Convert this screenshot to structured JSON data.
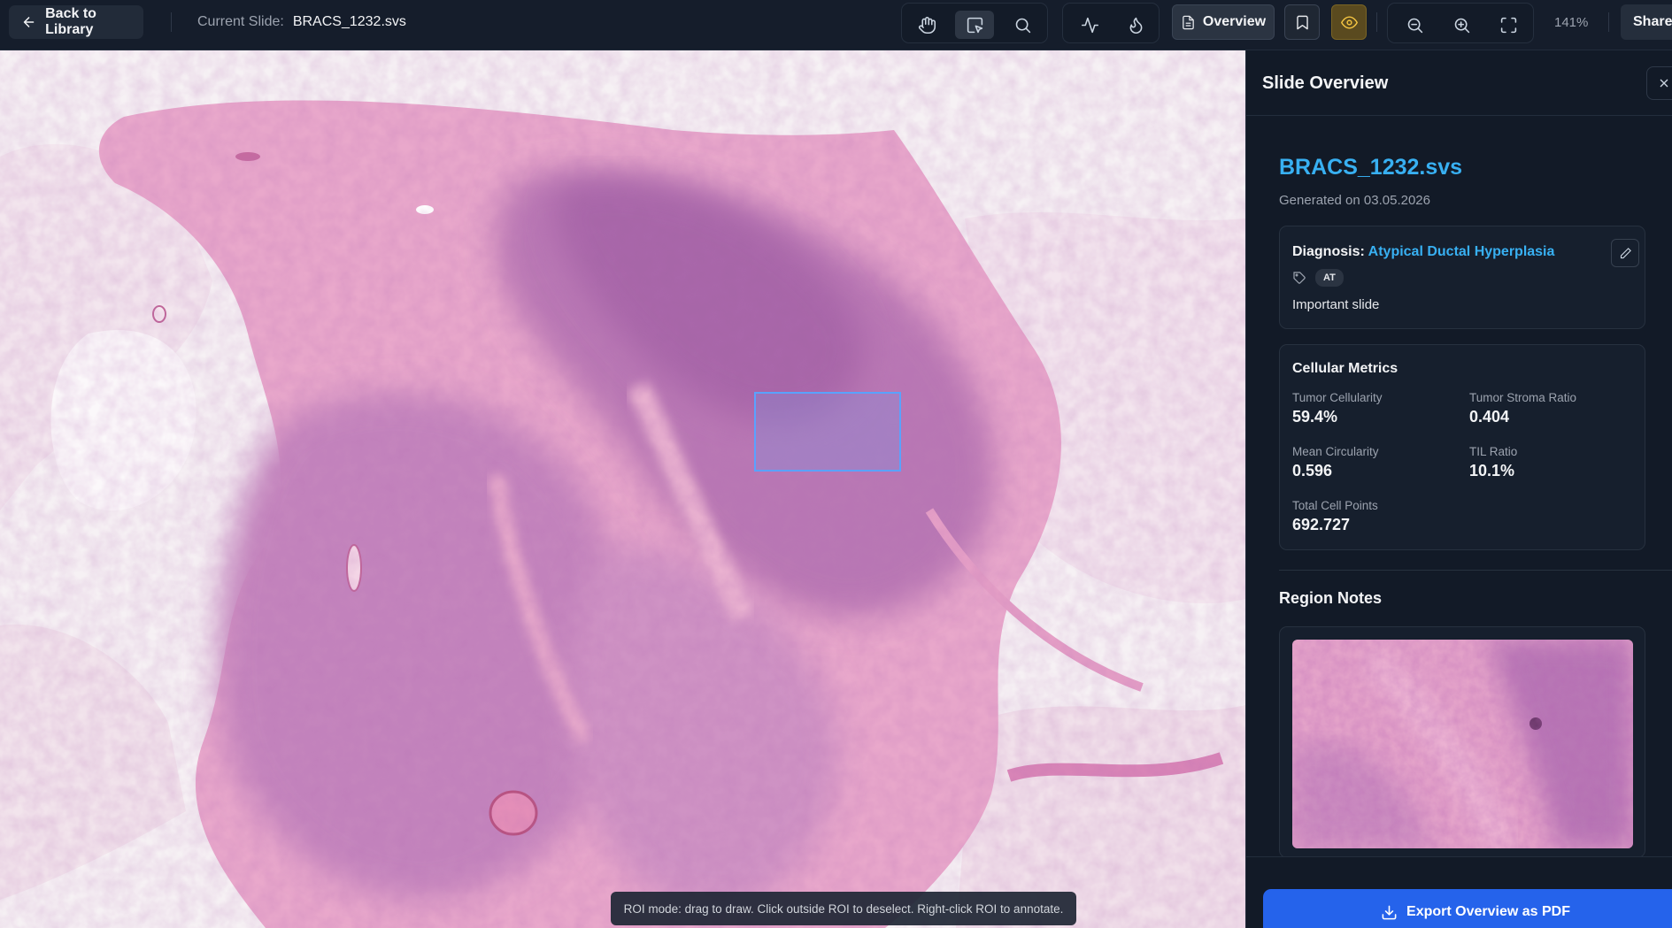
{
  "toolbar": {
    "back_label": "Back to Library",
    "current_slide_label": "Current Slide:",
    "current_slide_value": "BRACS_1232.svs",
    "overview_label": "Overview",
    "zoom_level": "141%",
    "share_label": "Share",
    "icons": [
      "pan-hand-icon",
      "roi-select-icon",
      "search-icon",
      "activity-icon",
      "flame-icon",
      "document-icon",
      "bookmark-icon",
      "eye-icon",
      "zoom-out-icon",
      "zoom-in-icon",
      "fullscreen-icon"
    ],
    "colors": {
      "active_eye_bg": "#5a4a1f",
      "active_eye_icon": "#f5c542"
    }
  },
  "viewer": {
    "hint": "ROI mode: drag to draw. Click outside ROI to deselect. Right-click ROI to annotate.",
    "roi_color": "#5aa2ff"
  },
  "panel": {
    "title": "Slide Overview",
    "slide_name": "BRACS_1232.svs",
    "generated": "Generated on 03.05.2026",
    "diagnosis": {
      "label": "Diagnosis:",
      "value": "Atypical Ductal Hyperplasia",
      "tag": "AT",
      "note": "Important slide"
    },
    "metrics": {
      "title": "Cellular Metrics",
      "items": [
        {
          "label": "Tumor Cellularity",
          "value": "59.4%"
        },
        {
          "label": "Tumor Stroma Ratio",
          "value": "0.404"
        },
        {
          "label": "Mean Circularity",
          "value": "0.596"
        },
        {
          "label": "TIL Ratio",
          "value": "10.1%"
        },
        {
          "label": "Total Cell Points",
          "value": "692.727"
        }
      ]
    },
    "region_notes_title": "Region Notes",
    "export_label": "Export Overview as PDF",
    "accent_color": "#38b0f2",
    "export_color": "#2563eb"
  }
}
